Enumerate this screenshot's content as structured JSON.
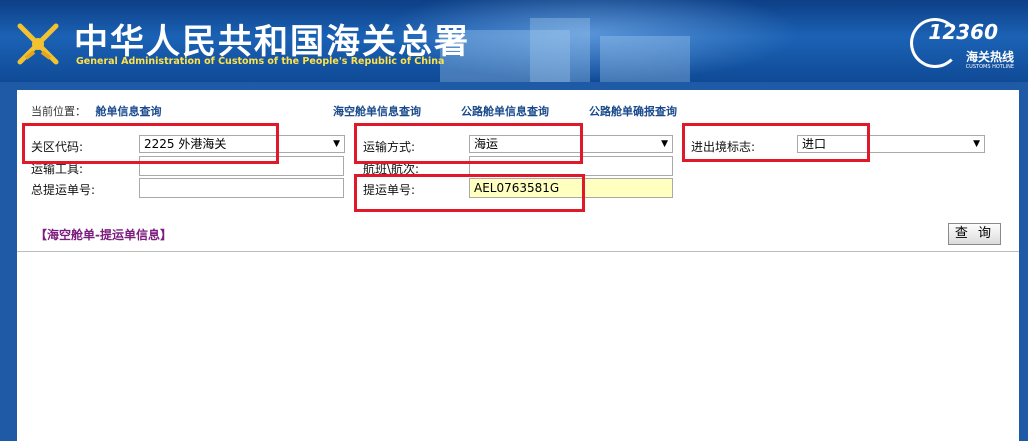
{
  "header": {
    "title_cn": "中华人民共和国海关总署",
    "title_en": "General Administration of Customs of the People's Republic of China",
    "hotline_number": "12360",
    "hotline_cn": "海关热线",
    "hotline_en": "CUSTOMS HOTLINE",
    "emblem_icon": "customs-emblem-icon"
  },
  "nav": {
    "location_label": "当前位置：",
    "location_value": "舱单信息查询",
    "links": [
      "海空舱单信息查询",
      "公路舱单信息查询",
      "公路舱单确报查询"
    ]
  },
  "form": {
    "customs_code_label": "关区代码:",
    "customs_code_value": "2225 外港海关",
    "transport_mode_label": "运输方式:",
    "transport_mode_value": "海运",
    "io_flag_label": "进出境标志:",
    "io_flag_value": "进口",
    "vehicle_label": "运输工具:",
    "voyage_label": "航班\\航次:",
    "master_bill_label": "总提运单号:",
    "bill_label": "提运单号:",
    "bill_value": "AEL0763581G"
  },
  "section_title": "【海空舱单-提运单信息】",
  "query_button": "查 询",
  "colors": {
    "highlight": "#e0192a",
    "section": "#7b1c7e",
    "nav": "#1a4a8c",
    "banner": "#1b62b5"
  }
}
